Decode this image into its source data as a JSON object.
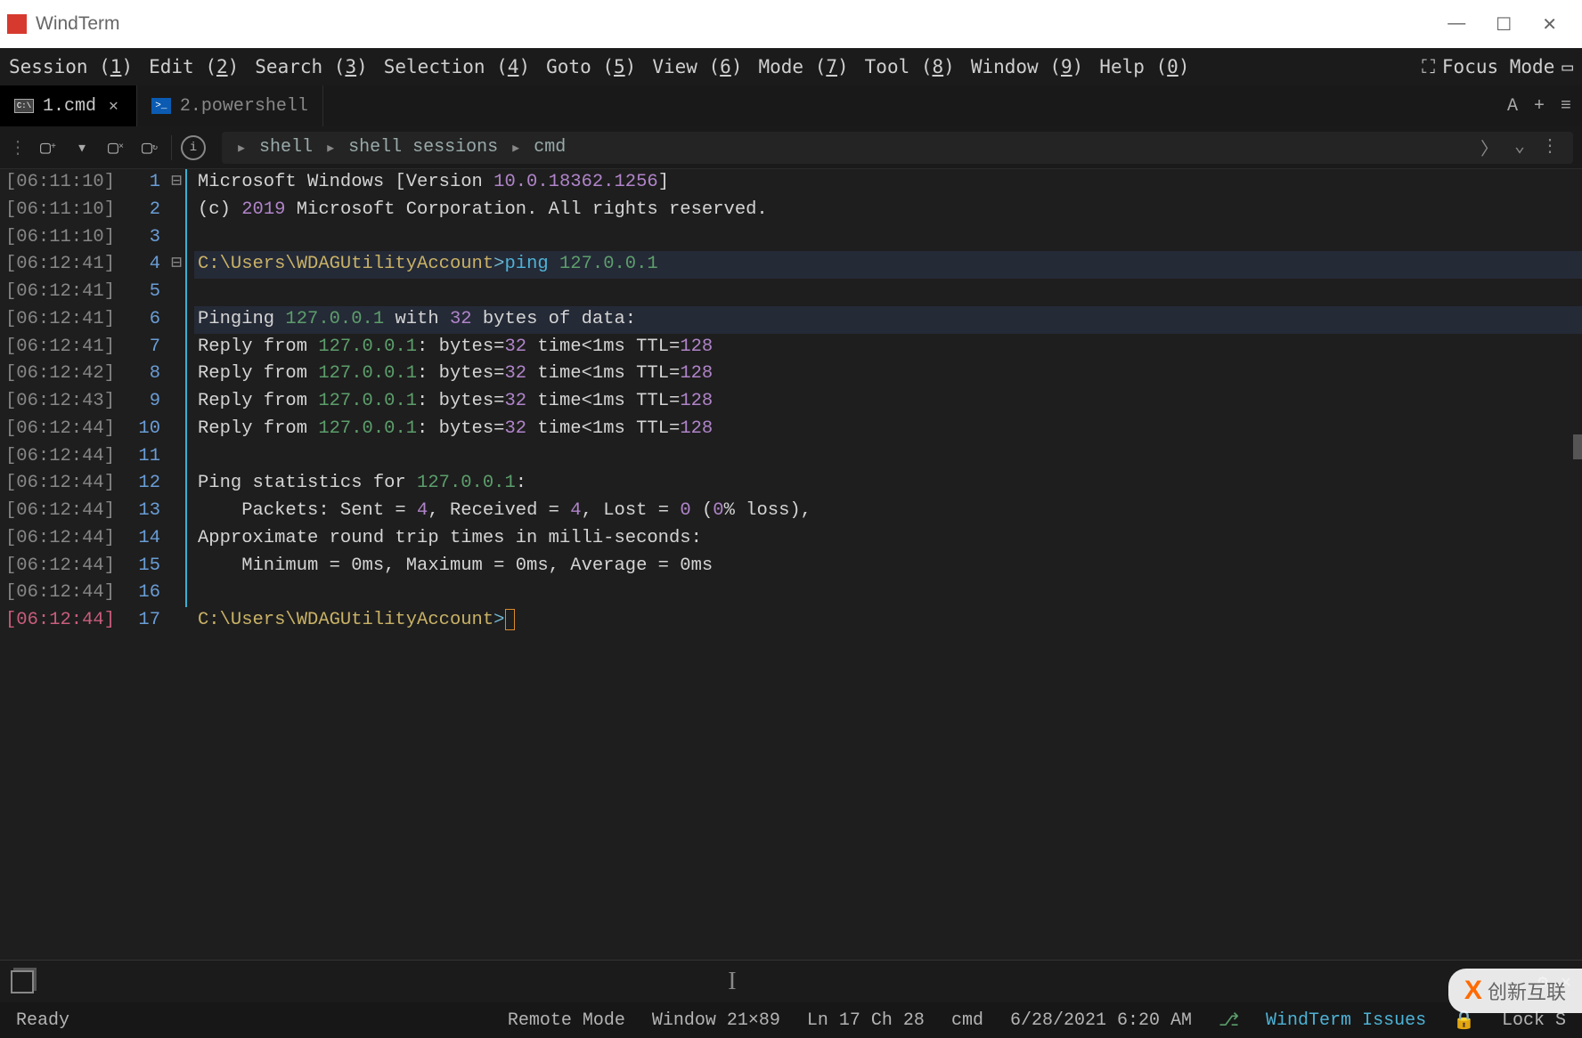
{
  "app": {
    "title": "WindTerm"
  },
  "window_controls": {
    "min": "—",
    "max": "☐",
    "close": "✕"
  },
  "menu": {
    "items": [
      {
        "label": "Session",
        "accel": "1"
      },
      {
        "label": "Edit",
        "accel": "2"
      },
      {
        "label": "Search",
        "accel": "3"
      },
      {
        "label": "Selection",
        "accel": "4"
      },
      {
        "label": "Goto",
        "accel": "5"
      },
      {
        "label": "View",
        "accel": "6"
      },
      {
        "label": "Mode",
        "accel": "7"
      },
      {
        "label": "Tool",
        "accel": "8"
      },
      {
        "label": "Window",
        "accel": "9"
      },
      {
        "label": "Help",
        "accel": "0"
      }
    ],
    "focus_mode": "Focus Mode"
  },
  "tabs": [
    {
      "label": "1.cmd",
      "icon": "cmd",
      "active": true,
      "closable": true
    },
    {
      "label": "2.powershell",
      "icon": "ps",
      "active": false,
      "closable": false
    }
  ],
  "tab_controls": {
    "font_size": "A",
    "add": "+",
    "menu": "≡"
  },
  "breadcrumb": [
    "shell",
    "shell sessions",
    "cmd"
  ],
  "terminal": {
    "lines": [
      {
        "ts": "[06:11:10]",
        "n": 1,
        "fold": "⊟",
        "tokens": [
          [
            "c-gray",
            "Microsoft Windows [Version "
          ],
          [
            "c-num",
            "10.0.18362.1256"
          ],
          [
            "c-gray",
            "]"
          ]
        ]
      },
      {
        "ts": "[06:11:10]",
        "n": 2,
        "fold": "",
        "tokens": [
          [
            "c-gray",
            "(c) "
          ],
          [
            "c-num",
            "2019"
          ],
          [
            "c-gray",
            " Microsoft Corporation. All rights reserved."
          ]
        ]
      },
      {
        "ts": "[06:11:10]",
        "n": 3,
        "fold": "",
        "tokens": []
      },
      {
        "ts": "[06:12:41]",
        "n": 4,
        "fold": "⊟",
        "hl": true,
        "tokens": [
          [
            "c-path",
            "C:\\Users\\WDAGUtilityAccount"
          ],
          [
            "c-prompt",
            ">"
          ],
          [
            "c-kw",
            "ping"
          ],
          [
            "c-gray",
            " "
          ],
          [
            "c-ip",
            "127.0.0.1"
          ]
        ]
      },
      {
        "ts": "[06:12:41]",
        "n": 5,
        "fold": "",
        "tokens": []
      },
      {
        "ts": "[06:12:41]",
        "n": 6,
        "fold": "",
        "hl": true,
        "tokens": [
          [
            "c-gray",
            "Pinging "
          ],
          [
            "c-ip",
            "127.0.0.1"
          ],
          [
            "c-gray",
            " with "
          ],
          [
            "c-num",
            "32"
          ],
          [
            "c-gray",
            " bytes of data:"
          ]
        ]
      },
      {
        "ts": "[06:12:41]",
        "n": 7,
        "fold": "",
        "tokens": [
          [
            "c-gray",
            "Reply from "
          ],
          [
            "c-ip",
            "127.0.0.1"
          ],
          [
            "c-gray",
            ": bytes="
          ],
          [
            "c-num",
            "32"
          ],
          [
            "c-gray",
            " time<1ms TTL="
          ],
          [
            "c-num",
            "128"
          ]
        ]
      },
      {
        "ts": "[06:12:42]",
        "n": 8,
        "fold": "",
        "tokens": [
          [
            "c-gray",
            "Reply from "
          ],
          [
            "c-ip",
            "127.0.0.1"
          ],
          [
            "c-gray",
            ": bytes="
          ],
          [
            "c-num",
            "32"
          ],
          [
            "c-gray",
            " time<1ms TTL="
          ],
          [
            "c-num",
            "128"
          ]
        ]
      },
      {
        "ts": "[06:12:43]",
        "n": 9,
        "fold": "",
        "tokens": [
          [
            "c-gray",
            "Reply from "
          ],
          [
            "c-ip",
            "127.0.0.1"
          ],
          [
            "c-gray",
            ": bytes="
          ],
          [
            "c-num",
            "32"
          ],
          [
            "c-gray",
            " time<1ms TTL="
          ],
          [
            "c-num",
            "128"
          ]
        ]
      },
      {
        "ts": "[06:12:44]",
        "n": 10,
        "fold": "",
        "tokens": [
          [
            "c-gray",
            "Reply from "
          ],
          [
            "c-ip",
            "127.0.0.1"
          ],
          [
            "c-gray",
            ": bytes="
          ],
          [
            "c-num",
            "32"
          ],
          [
            "c-gray",
            " time<1ms TTL="
          ],
          [
            "c-num",
            "128"
          ]
        ]
      },
      {
        "ts": "[06:12:44]",
        "n": 11,
        "fold": "",
        "tokens": []
      },
      {
        "ts": "[06:12:44]",
        "n": 12,
        "fold": "",
        "tokens": [
          [
            "c-gray",
            "Ping statistics for "
          ],
          [
            "c-ip",
            "127.0.0.1"
          ],
          [
            "c-gray",
            ":"
          ]
        ]
      },
      {
        "ts": "[06:12:44]",
        "n": 13,
        "fold": "",
        "tokens": [
          [
            "c-gray",
            "    Packets: Sent = "
          ],
          [
            "c-num",
            "4"
          ],
          [
            "c-gray",
            ", Received = "
          ],
          [
            "c-num",
            "4"
          ],
          [
            "c-gray",
            ", Lost = "
          ],
          [
            "c-num",
            "0"
          ],
          [
            "c-gray",
            " ("
          ],
          [
            "c-num",
            "0"
          ],
          [
            "c-gray",
            "% loss),"
          ]
        ]
      },
      {
        "ts": "[06:12:44]",
        "n": 14,
        "fold": "",
        "tokens": [
          [
            "c-gray",
            "Approximate round trip times in milli-seconds:"
          ]
        ]
      },
      {
        "ts": "[06:12:44]",
        "n": 15,
        "fold": "",
        "tokens": [
          [
            "c-gray",
            "    Minimum = 0ms, Maximum = 0ms, Average = 0ms"
          ]
        ]
      },
      {
        "ts": "[06:12:44]",
        "n": 16,
        "fold": "",
        "tokens": []
      },
      {
        "ts": "[06:12:44]",
        "n": 17,
        "fold": "",
        "active": true,
        "tokens": [
          [
            "c-path",
            "C:\\Users\\WDAGUtilityAccount"
          ],
          [
            "c-prompt",
            ">"
          ]
        ],
        "cursor": true
      }
    ]
  },
  "bottombar": {
    "settings_icon": "⚙",
    "close_icon": "✕"
  },
  "status": {
    "ready": "Ready",
    "remote": "Remote Mode",
    "window": "Window 21×89",
    "pos": "Ln 17 Ch 28",
    "shell": "cmd",
    "datetime": "6/28/2021 6:20 AM",
    "issues": "WindTerm Issues",
    "lock": "Lock S"
  },
  "watermark": {
    "brand": "创新互联",
    "logo": "X"
  }
}
